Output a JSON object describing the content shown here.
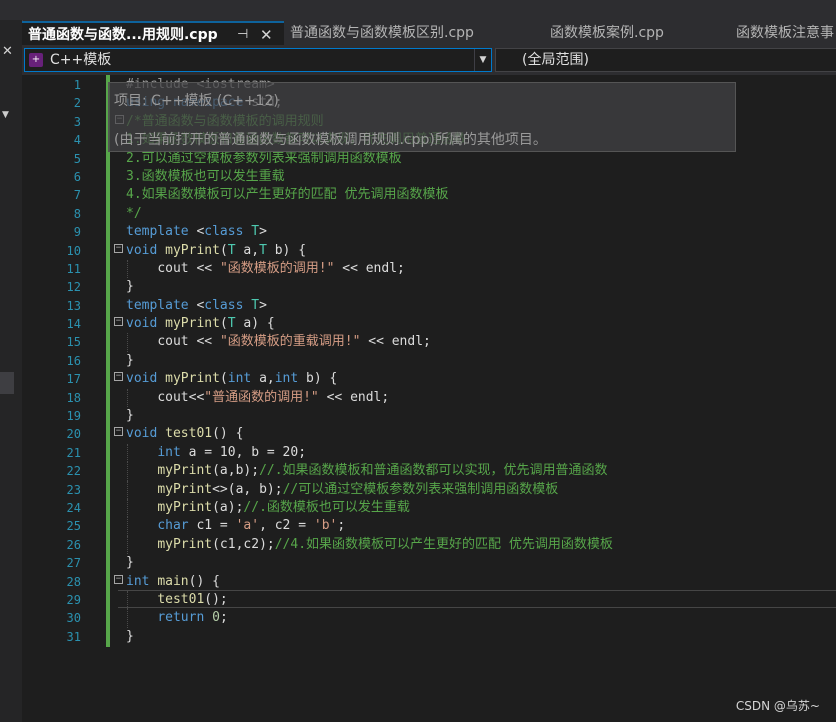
{
  "tabs": [
    {
      "label": "普通函数与函数...用规则.cpp",
      "pin": "⊣",
      "close": "✕"
    },
    {
      "label": "普通函数与函数模板区别.cpp"
    },
    {
      "label": "函数模板案例.cpp"
    },
    {
      "label": "函数模板注意事"
    }
  ],
  "navbar": {
    "project_label": "C++模板",
    "scope_label": "(全局范围)",
    "project_icon": "cpp-project-icon"
  },
  "tooltip": {
    "line1": "项目: C++模板 (C++12)",
    "line2": "(由于当前打开的普通函数与函数模板调用规则.cpp)所属的其他项目。"
  },
  "code_lines": [
    {
      "n": "1"
    },
    {
      "n": "2"
    },
    {
      "n": "3"
    },
    {
      "n": "4"
    },
    {
      "n": "5"
    },
    {
      "n": "6"
    },
    {
      "n": "7"
    },
    {
      "n": "8"
    },
    {
      "n": "9"
    },
    {
      "n": "10"
    },
    {
      "n": "11"
    },
    {
      "n": "12"
    },
    {
      "n": "13"
    },
    {
      "n": "14"
    },
    {
      "n": "15"
    },
    {
      "n": "16"
    },
    {
      "n": "17"
    },
    {
      "n": "18"
    },
    {
      "n": "19"
    },
    {
      "n": "20"
    },
    {
      "n": "21"
    },
    {
      "n": "22"
    },
    {
      "n": "23"
    },
    {
      "n": "24"
    },
    {
      "n": "25"
    },
    {
      "n": "26"
    },
    {
      "n": "27"
    },
    {
      "n": "28"
    },
    {
      "n": "29"
    },
    {
      "n": "30"
    },
    {
      "n": "31"
    }
  ],
  "code": {
    "l1": "#include <iostream>",
    "l2a": "using",
    "l2b": " namespace",
    "l2c": " std;",
    "l3": "/*普通函数与函数模板的调用规则",
    "l4": "1.如果函数模板和普通函数都可以实现，优先调用普通函数",
    "l5": "2.可以通过空模板参数列表来强制调用函数模板",
    "l6": "3.函数模板也可以发生重载",
    "l7": "4.如果函数模板可以产生更好的匹配 优先调用函数模板",
    "l8": "*/",
    "template": "template",
    "class": "class",
    "T": "T",
    "void": "void",
    "myPrint": "myPrint",
    "int": "int",
    "char": "char",
    "return": "return",
    "cout": "cout",
    "endl": "endl",
    "l11str": "\"函数模板的调用!\"",
    "l15str": "\"函数模板的重载调用!\"",
    "l18str": "\"普通函数的调用!\"",
    "test01": "test01",
    "main": "main",
    "l21": " a = 10, b = 20;",
    "c22": "//.如果函数模板和普通函数都可以实现，优先调用普通函数",
    "c23": "//可以通过空模板参数列表来强制调用函数模板",
    "c24": "//.函数模板也可以发生重载",
    "c26": "//4.如果函数模板可以产生更好的匹配 优先调用函数模板",
    "l25a": " c1 = ",
    "l25b": "'a'",
    "l25c": ", c2 = ",
    "l25d": "'b'",
    "l25e": ";",
    "zero": "0"
  },
  "watermark": "CSDN @乌苏~"
}
